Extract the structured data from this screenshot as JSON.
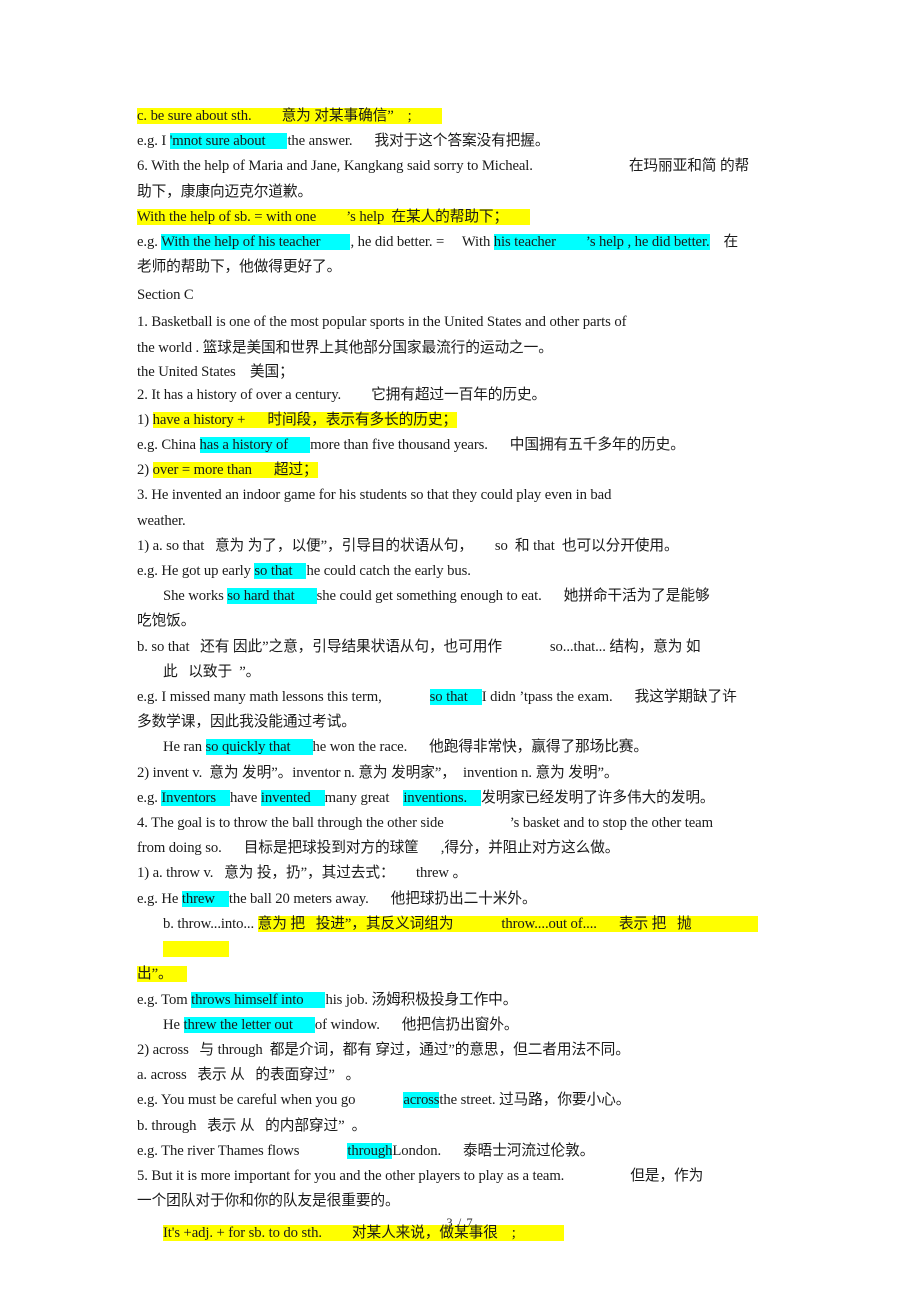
{
  "document": {
    "footer_page_label": "3 / 7",
    "colors": {
      "highlight_yellow": "#ffff00",
      "highlight_cyan": "#00ffff",
      "text": "#1a1a1a",
      "background": "#ffffff"
    }
  },
  "lines": {
    "l1_hl": "c. be sure about sth.",
    "l1_hl2": "意为 对某事确信”",
    "l1_hl3": ";",
    "l2_a": "e.g. I ",
    "l2_hl": "'mnot sure about",
    "l2_b": "the answer.",
    "l2_c": "我对于这个答案没有把握。",
    "l3_a": "6. With the help of Maria and Jane, Kangkang said sorry to Micheal.",
    "l3_b": "在玛丽亚和简 的帮",
    "l4": "助下，康康向迈克尔道歉。",
    "l5_hl": "With the help of sb. = with one",
    "l5_hl2": "’s help  在某人的帮助下；",
    "l6_a": "e.g. ",
    "l6_hl": "With the help of his teacher",
    "l6_b": ", he did better. = ",
    "l6_c": "With ",
    "l6_hl2": "his teacher",
    "l6_hl3": "’s help , he did better.",
    "l6_d": "在",
    "l7": "老师的帮助下，他做得更好了。",
    "l8": "Section C",
    "l9": "1. Basketball is one of the most popular sports in the United States and other parts of",
    "l10": "the world . 篮球是美国和世界上其他部分国家最流行的运动之一。",
    "l11": "the United States    美国；",
    "l12_a": "2. It has a history of over a century.",
    "l12_b": "它拥有超过一百年的历史。",
    "l13_a": "1) ",
    "l13_hl": "have a history +",
    "l13_hl2": "时间段，表示有多长的历史；",
    "l14_a": "e.g. China ",
    "l14_hl": "has a history of",
    "l14_b": "more than five thousand years.",
    "l14_c": "中国拥有五千多年的历史。",
    "l15_a": "2) ",
    "l15_hl": "over = more than",
    "l15_hl2": "超过；",
    "l16": "3. He invented an indoor game for his students so that they could play even in bad",
    "l17": "weather.",
    "l18_a": "1) a. so that   意为 为了，以便”，引导目的状语从句，",
    "l18_b": "so  和 that  也可以分开使用。",
    "l19_a": "e.g. He got up early ",
    "l19_hl": "so that",
    "l19_b": "he could catch the early bus.",
    "l20_a": "She works ",
    "l20_hl": "so hard that",
    "l20_b": "she could get something enough to eat.",
    "l20_c": "她拼命干活为了是能够",
    "l21": "吃饱饭。",
    "l22_a": "b. so that   还有 因此”之意，引导结果状语从句，也可用作",
    "l22_b": "so...that... 结构，意为 如",
    "l23": "此   以致于  ”。",
    "l24_a": "e.g. I missed many math lessons this term,",
    "l24_hl": "so that",
    "l24_b": "I didn ’tpass the exam.",
    "l24_c": "我这学期缺了许",
    "l25": "多数学课，因此我没能通过考试。",
    "l26_a": "He ran ",
    "l26_hl": "so quickly that",
    "l26_b": "he won the race.",
    "l26_c": "他跑得非常快，赢得了那场比赛。",
    "l27": "2) invent v.  意为 发明”。inventor n. 意为 发明家”，  invention n. 意为 发明”。",
    "l28_a": "e.g. ",
    "l28_hl": "Inventors",
    "l28_b": "have ",
    "l28_hl2": "invented",
    "l28_c": "many great",
    "l28_hl3": "inventions.",
    "l28_d": "发明家已经发明了许多伟大的发明。",
    "l29_a": "4. The goal is to throw the ball through the other side",
    "l29_b": "’s basket and to stop the other team",
    "l30_a": "from doing so.",
    "l30_b": "目标是把球投到对方的球筐",
    "l30_c": ",得分，并阻止对方这么做。",
    "l31": "1) a. throw v.   意为 投，扔”，其过去式：      threw 。",
    "l32_a": "e.g. He ",
    "l32_hl": "threw",
    "l32_b": "the ball 20 meters away.",
    "l32_c": "他把球扔出二十米外。",
    "l33_a": "b. throw...into... ",
    "l33_hl": "意为 把   投进”，其反义词组为",
    "l33_hl2": "throw....out of....",
    "l33_hl3": "表示 把   抛",
    "l34_hl": "出”。",
    "l35_a": "e.g. Tom ",
    "l35_hl": "throws himself into",
    "l35_b": "his job. 汤姆积极投身工作中。",
    "l36_a": "He ",
    "l36_hl": "threw the letter out",
    "l36_b": "of window.",
    "l36_c": "他把信扔出窗外。",
    "l37": "2) across   与 through  都是介词，都有 穿过，通过”的意思，但二者用法不同。",
    "l38": "a. across   表示 从   的表面穿过”   。",
    "l39_a": "e.g. You must be careful when you go",
    "l39_hl": "across",
    "l39_b": "the street. 过马路，你要小心。",
    "l40": "b. through   表示 从   的内部穿过”  。",
    "l41_a": "e.g. The river Thames flows",
    "l41_hl": "through",
    "l41_b": "London.",
    "l41_c": "泰晤士河流过伦敦。",
    "l42_a": "5. But it is more important for you and the other players to play as a team.",
    "l42_b": "但是，作为",
    "l43": "一个团队对于你和你的队友是很重要的。",
    "l44_hl": "It's +adj. + for sb. to do sth.",
    "l44_hl2": "对某人来说，做某事很",
    "l44_hl3": ";"
  }
}
